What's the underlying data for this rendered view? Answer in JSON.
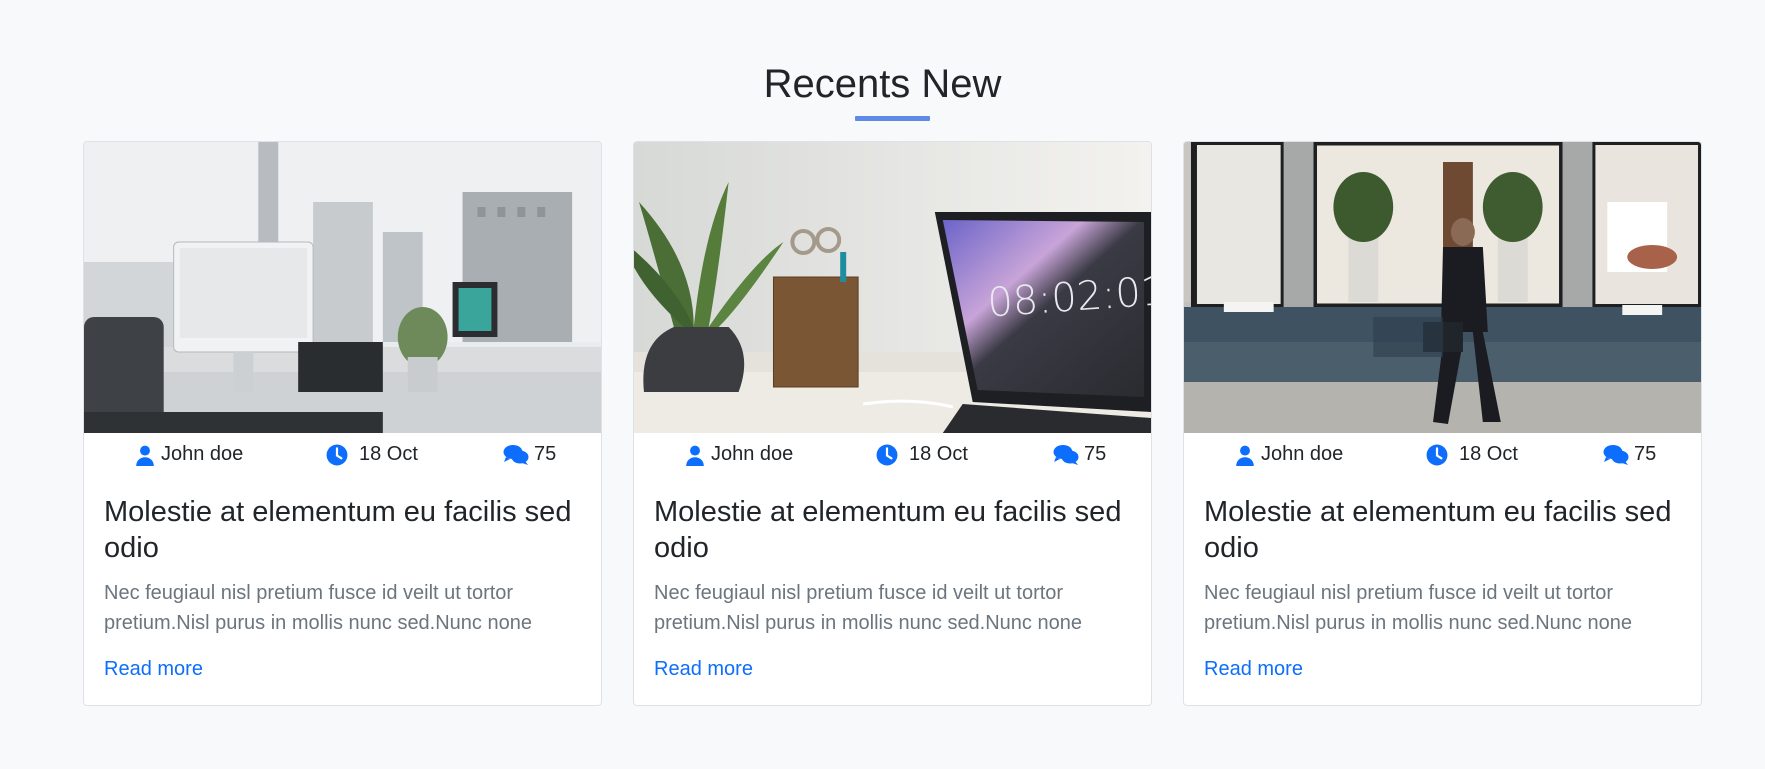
{
  "section": {
    "title": "Recents New",
    "accent_color": "#5f8be8"
  },
  "posts": [
    {
      "image": "office-desk-with-imac-photo",
      "author": "John doe",
      "date": "18 Oct",
      "comments": "75",
      "title": "Molestie at elementum eu facilis sed odio",
      "excerpt": "Nec feugiaul nisl pretium fusce id veilt ut tortor pretium.Nisl purus in mollis nunc sed.Nunc none",
      "link": "Read more"
    },
    {
      "image": "desk-with-plant-pencil-cup-laptop-photo",
      "author": "John doe",
      "date": "18 Oct",
      "comments": "75",
      "title": "Molestie at elementum eu facilis sed odio",
      "excerpt": "Nec feugiaul nisl pretium fusce id veilt ut tortor pretium.Nisl purus in mollis nunc sed.Nunc none",
      "link": "Read more",
      "image_text": "08:02:01"
    },
    {
      "image": "businessman-walking-past-storefront-photo",
      "author": "John doe",
      "date": "18 Oct",
      "comments": "75",
      "title": "Molestie at elementum eu facilis sed odio",
      "excerpt": "Nec feugiaul nisl pretium fusce id veilt ut tortor pretium.Nisl purus in mollis nunc sed.Nunc none",
      "link": "Read more"
    }
  ],
  "icons": {
    "author": "user-icon",
    "date": "clock-icon",
    "comments": "comments-icon"
  },
  "colors": {
    "link": "#0d6efd",
    "icon": "#0d6efd",
    "muted_text": "#6c757d"
  }
}
